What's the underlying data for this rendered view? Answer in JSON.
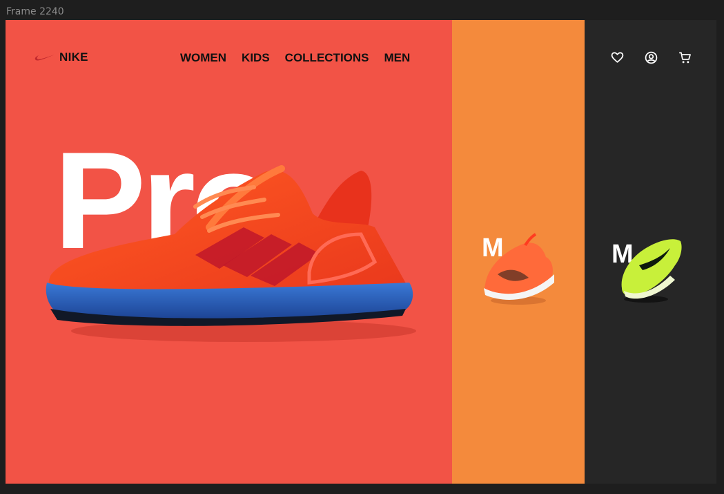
{
  "window": {
    "frame_label": "Frame 2240"
  },
  "brand": {
    "name": "NIKE",
    "logo_icon": "swoosh-icon"
  },
  "nav": {
    "items": [
      "WOMEN",
      "KIDS",
      "COLLECTIONS",
      "MEN"
    ]
  },
  "header_icons": [
    "heart-icon",
    "user-circle-icon",
    "cart-icon"
  ],
  "hero": {
    "word": "Pro"
  },
  "cards": [
    {
      "letter": "M",
      "background": "#f48a3c"
    },
    {
      "letter": "M",
      "background": "#262626"
    }
  ],
  "colors": {
    "panel_red": "#f25346",
    "panel_orange": "#f48a3c",
    "panel_dark": "#262626"
  }
}
